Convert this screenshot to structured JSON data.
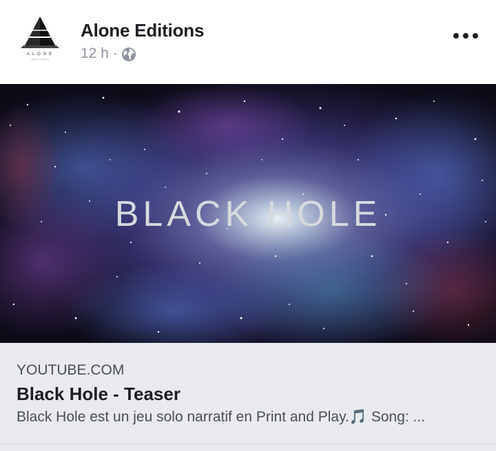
{
  "post": {
    "page_name": "Alone Editions",
    "timestamp": "12 h",
    "separator": "·",
    "privacy_icon": "globe-icon",
    "more_icon": "more-options-icon"
  },
  "avatar": {
    "logo_text": "ALONE",
    "logo_subtext": "EDITIONS"
  },
  "media": {
    "title_text": "BLACK HOLE"
  },
  "link": {
    "domain": "YOUTUBE.COM",
    "title": "Black Hole - Teaser",
    "description": "Black Hole est un jeu solo narratif en Print and Play.🎵 Song: ..."
  },
  "colors": {
    "card_background": "#e9eaee",
    "secondary_text": "#8d949e"
  }
}
